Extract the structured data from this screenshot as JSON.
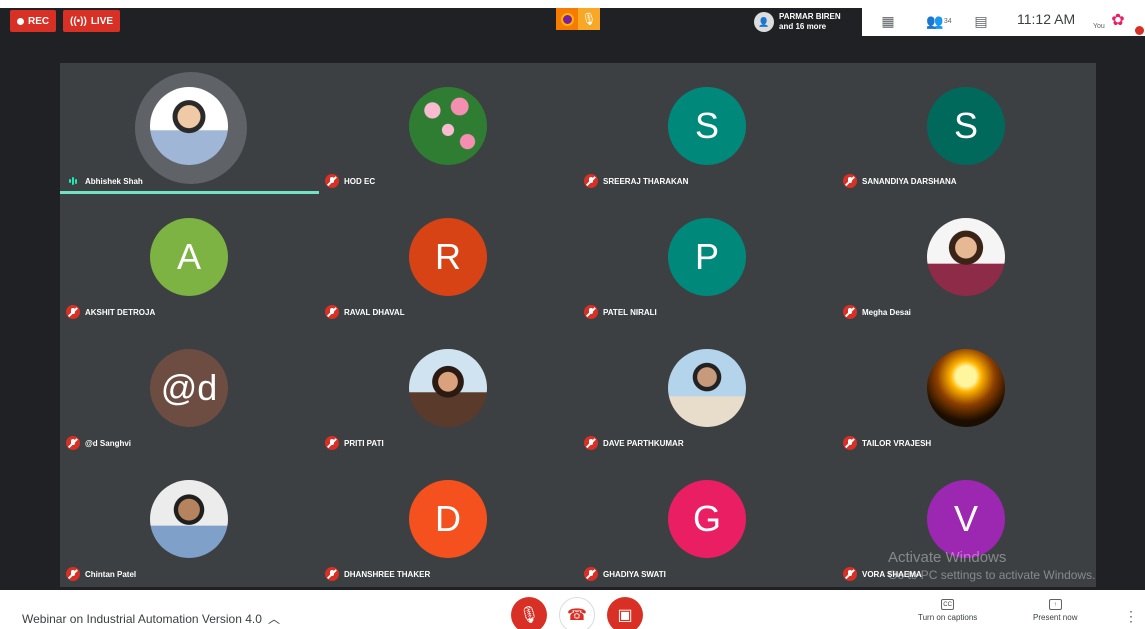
{
  "top_left": {
    "rec_label": "REC",
    "live_label": "LIVE"
  },
  "top_right": {
    "presenter": {
      "name": "PARMAR BIREN",
      "sub": "and 16 more"
    },
    "participants_count": "34",
    "time": "11:12 AM",
    "you_label": "You"
  },
  "participants": [
    {
      "name": "Abhishek Shah",
      "speaking": true,
      "avatar_type": "photo",
      "photo": "person",
      "muted": false
    },
    {
      "name": "HOD EC",
      "avatar_type": "photo",
      "photo": "flowers",
      "muted": true
    },
    {
      "name": "SREERAJ THARAKAN",
      "avatar_type": "letter",
      "letter": "S",
      "color": "#00897b",
      "muted": true
    },
    {
      "name": "SANANDIYA DARSHANA",
      "avatar_type": "letter",
      "letter": "S",
      "color": "#00695c",
      "muted": true
    },
    {
      "name": "AKSHIT DETROJA",
      "avatar_type": "letter",
      "letter": "A",
      "color": "#7cb342",
      "muted": true
    },
    {
      "name": "RAVAL DHAVAL",
      "avatar_type": "letter",
      "letter": "R",
      "color": "#d84315",
      "muted": true
    },
    {
      "name": "PATEL NIRALI",
      "avatar_type": "letter",
      "letter": "P",
      "color": "#00897b",
      "muted": true
    },
    {
      "name": "Megha Desai",
      "avatar_type": "photo",
      "photo": "woman1",
      "muted": true
    },
    {
      "name": "@d Sanghvi",
      "avatar_type": "letter",
      "letter": "@d",
      "color": "#6d4c41",
      "muted": true
    },
    {
      "name": "PRITI PATI",
      "avatar_type": "photo",
      "photo": "woman2",
      "muted": true
    },
    {
      "name": "DAVE PARTHKUMAR",
      "avatar_type": "photo",
      "photo": "man2",
      "muted": true
    },
    {
      "name": "TAILOR VRAJESH",
      "avatar_type": "photo",
      "photo": "sun",
      "muted": true
    },
    {
      "name": "Chintan Patel",
      "avatar_type": "photo",
      "photo": "man3",
      "muted": true
    },
    {
      "name": "DHANSHREE THAKER",
      "avatar_type": "letter",
      "letter": "D",
      "color": "#f4511e",
      "muted": true
    },
    {
      "name": "GHADIYA SWATI",
      "avatar_type": "letter",
      "letter": "G",
      "color": "#e91e63",
      "muted": true
    },
    {
      "name": "VORA SHAEMA",
      "avatar_type": "letter",
      "letter": "V",
      "color": "#9c27b0",
      "muted": true
    }
  ],
  "watermark": {
    "line1": "Activate Windows",
    "line2": "Go to PC settings to activate Windows."
  },
  "bottom": {
    "meeting_title": "Webinar on Industrial Automation Version 4.0",
    "captions_label": "Turn on captions",
    "present_label": "Present now"
  }
}
